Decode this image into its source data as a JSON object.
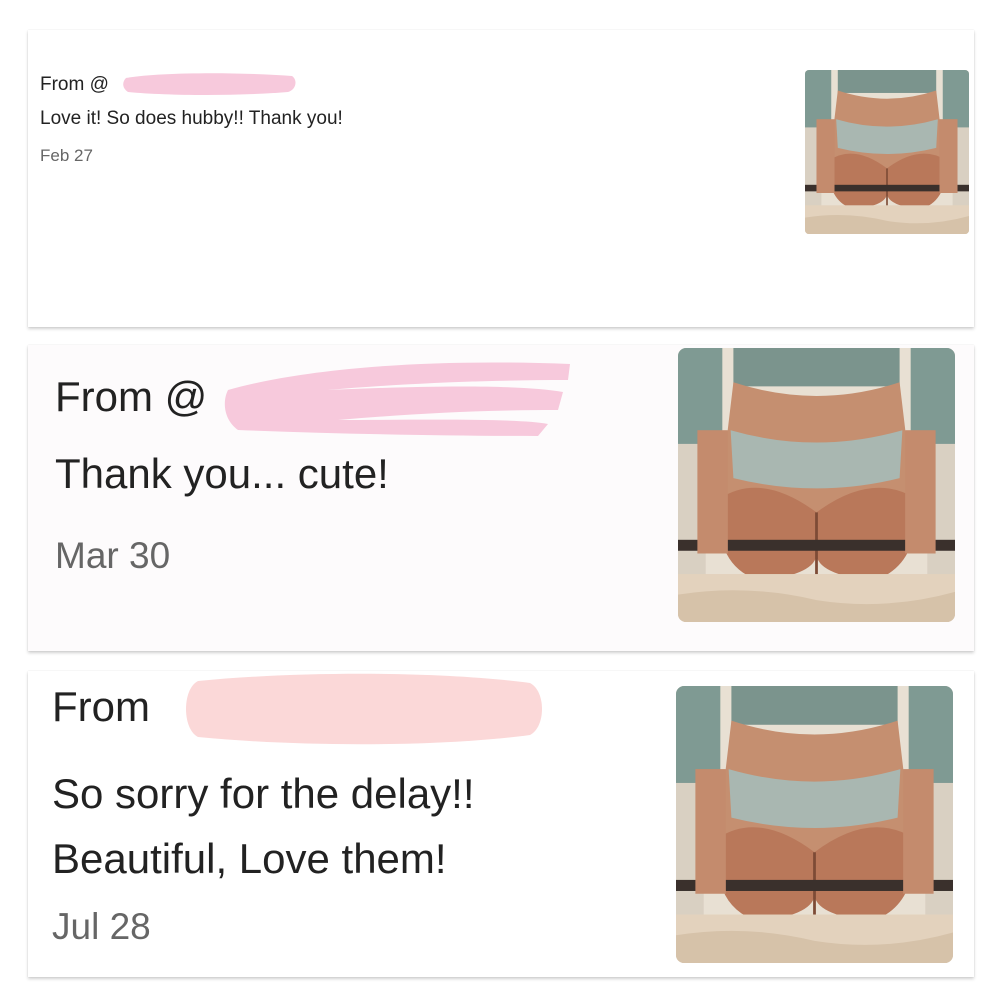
{
  "messages": [
    {
      "from_label": "From @",
      "text": "Love it! So does hubby!! Thank you!",
      "date": "Feb 27"
    },
    {
      "from_label": "From @",
      "text": "Thank you... cute!",
      "date": "Mar 30"
    },
    {
      "from_label": "From",
      "text": "So sorry for the delay!!\nBeautiful, Love them!",
      "date": "Jul 28"
    }
  ],
  "colors": {
    "redaction": "#f7c9dc",
    "redaction_soft": "#fbd8d8",
    "date_text": "#666666",
    "body_text": "#222222"
  },
  "icons": {
    "thumbnail": "product-photo-thumbnail"
  }
}
